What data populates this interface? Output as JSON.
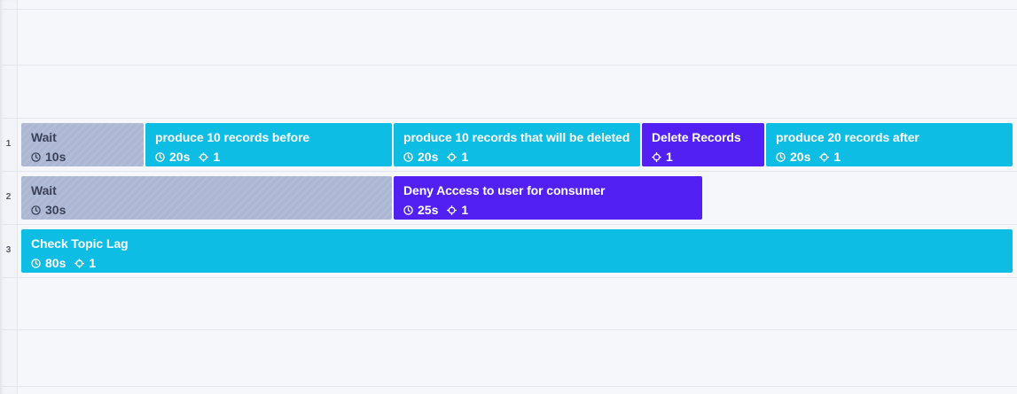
{
  "lanes": [
    "1",
    "2",
    "3"
  ],
  "blocks": [
    {
      "lane": "1",
      "kind": "wait",
      "title": "Wait",
      "duration": "10s",
      "color": "#acb7d4"
    },
    {
      "lane": "1",
      "kind": "task",
      "title": "produce 10 records before",
      "duration": "20s",
      "targets": "1",
      "color": "#0ebde3"
    },
    {
      "lane": "1",
      "kind": "task",
      "title": "produce 10 records that will be deleted",
      "duration": "20s",
      "targets": "1",
      "color": "#0ebde3"
    },
    {
      "lane": "1",
      "kind": "action",
      "title": "Delete Records",
      "targets": "1",
      "color": "#5320f4"
    },
    {
      "lane": "1",
      "kind": "task",
      "title": "produce 20 records after",
      "duration": "20s",
      "targets": "1",
      "color": "#0ebde3"
    },
    {
      "lane": "2",
      "kind": "wait",
      "title": "Wait",
      "duration": "30s",
      "color": "#acb7d4"
    },
    {
      "lane": "2",
      "kind": "action",
      "title": "Deny Access to user for consumer",
      "duration": "25s",
      "targets": "1",
      "color": "#5320f4"
    },
    {
      "lane": "3",
      "kind": "task",
      "title": "Check Topic Lag",
      "duration": "80s",
      "targets": "1",
      "color": "#0ebde3"
    }
  ],
  "icons": {
    "duration": "clock-icon",
    "targets": "crosshair-icon"
  }
}
